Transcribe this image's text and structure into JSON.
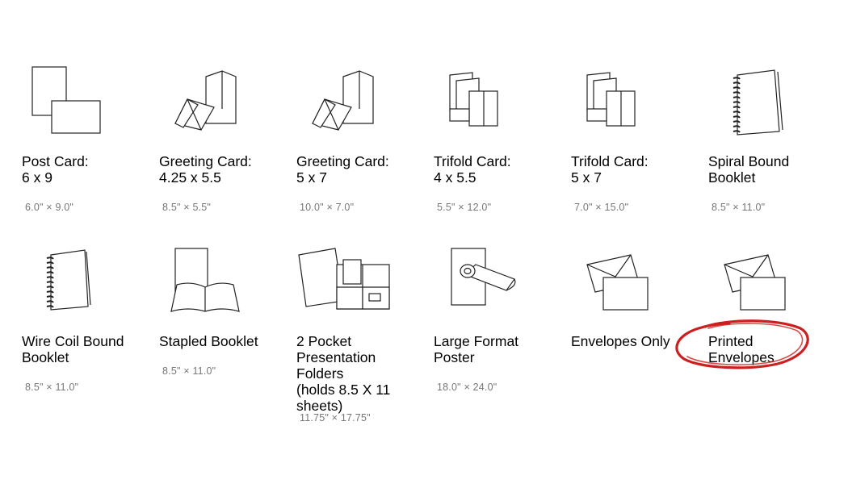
{
  "products": [
    {
      "label": "Post Card:\n6 x 9",
      "dims": "6.0\" × 9.0\"",
      "icon": "postcard-icon"
    },
    {
      "label": "Greeting Card:\n4.25 x 5.5",
      "dims": "8.5\" × 5.5\"",
      "icon": "greeting-card-icon"
    },
    {
      "label": "Greeting Card:\n5 x 7",
      "dims": "10.0\" × 7.0\"",
      "icon": "greeting-card-icon"
    },
    {
      "label": "Trifold Card:\n4 x 5.5",
      "dims": "5.5\" × 12.0\"",
      "icon": "trifold-card-icon"
    },
    {
      "label": "Trifold Card:\n5 x 7",
      "dims": "7.0\" × 15.0\"",
      "icon": "trifold-card-icon"
    },
    {
      "label": "Spiral Bound\nBooklet",
      "dims": "8.5\" × 11.0\"",
      "icon": "spiral-booklet-icon"
    },
    {
      "label": "Wire Coil Bound\nBooklet",
      "dims": "8.5\" × 11.0\"",
      "icon": "wire-coil-booklet-icon"
    },
    {
      "label": "Stapled Booklet",
      "dims": "8.5\" × 11.0\"",
      "icon": "stapled-booklet-icon"
    },
    {
      "label": "2 Pocket\nPresentation\nFolders\n(holds 8.5 X 11\nsheets)",
      "dims": "11.75\" × 17.75\"",
      "icon": "pocket-folder-icon"
    },
    {
      "label": "Large Format\nPoster",
      "dims": "18.0\" × 24.0\"",
      "icon": "poster-icon"
    },
    {
      "label": "Envelopes Only",
      "dims": "",
      "icon": "envelope-icon"
    },
    {
      "label": "Printed\nEnvelopes",
      "dims": "",
      "icon": "envelope-icon"
    }
  ],
  "annotation": {
    "color": "#cc1f1f",
    "target": "Printed Envelopes"
  }
}
